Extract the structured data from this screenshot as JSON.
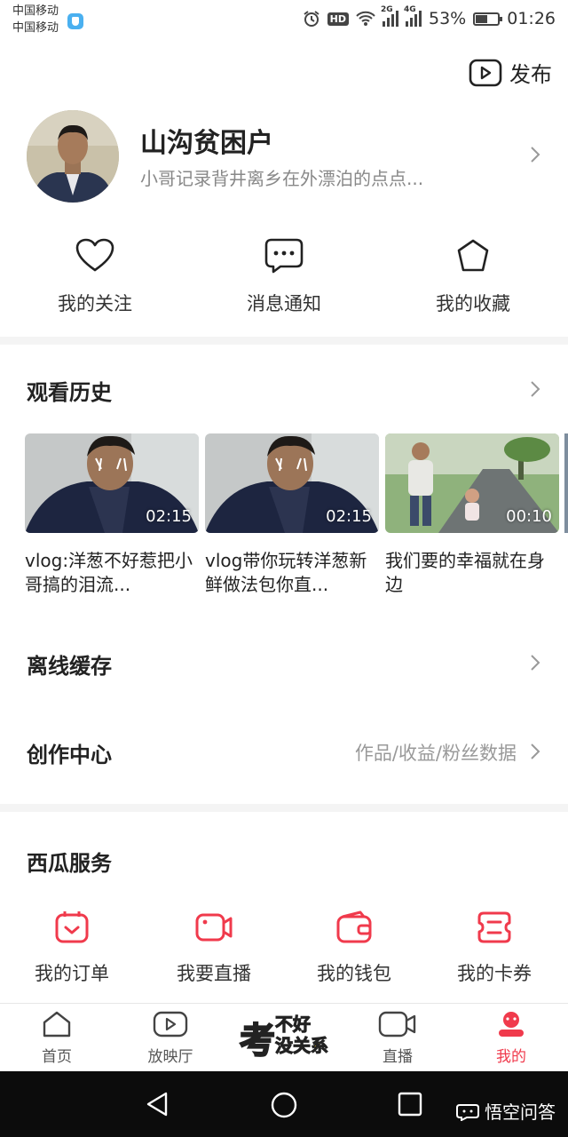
{
  "status_bar": {
    "carrier_1": "中国移动",
    "carrier_2": "中国移动",
    "hd": "HD",
    "net_1": "2G",
    "net_2": "4G",
    "battery": "53%",
    "time": "01:26"
  },
  "header": {
    "publish_label": "发布"
  },
  "profile": {
    "name": "山沟贫困户",
    "bio": "小哥记录背井离乡在外漂泊的点点..."
  },
  "quick_actions": [
    {
      "label": "我的关注",
      "icon": "heart-icon"
    },
    {
      "label": "消息通知",
      "icon": "message-icon"
    },
    {
      "label": "我的收藏",
      "icon": "star-icon"
    }
  ],
  "history": {
    "title": "观看历史",
    "videos": [
      {
        "title": "vlog:洋葱不好惹把小哥搞的泪流...",
        "duration": "02:15"
      },
      {
        "title": "vlog带你玩转洋葱新鲜做法包你直...",
        "duration": "02:15"
      },
      {
        "title": "我们要的幸福就在身边",
        "duration": "00:10"
      }
    ]
  },
  "offline": {
    "title": "离线缓存"
  },
  "creator": {
    "title": "创作中心",
    "subtitle": "作品/收益/粉丝数据"
  },
  "services": {
    "title": "西瓜服务",
    "items": [
      {
        "label": "我的订单",
        "icon": "order-icon"
      },
      {
        "label": "我要直播",
        "icon": "live-camera-icon"
      },
      {
        "label": "我的钱包",
        "icon": "wallet-icon"
      },
      {
        "label": "我的卡券",
        "icon": "coupon-icon"
      }
    ]
  },
  "tabbar": {
    "items": [
      {
        "label": "首页",
        "icon": "home-icon"
      },
      {
        "label": "放映厅",
        "icon": "theater-icon"
      },
      {
        "label": "直播",
        "icon": "live-icon"
      },
      {
        "label": "我的",
        "icon": "profile-icon",
        "active": true
      }
    ],
    "promo": {
      "line1": "考",
      "line2": "不好",
      "line3": "没关系"
    }
  },
  "watermark": "悟空问答",
  "colors": {
    "accent": "#f03a4c",
    "text": "#222222",
    "muted": "#888888"
  }
}
